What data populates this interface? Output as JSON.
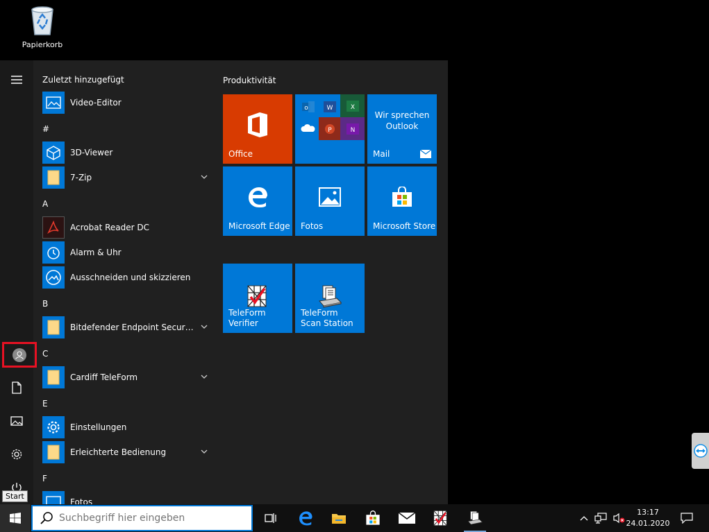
{
  "desktop": {
    "recycle_bin_label": "Papierkorb"
  },
  "start_menu": {
    "tooltip": "Start",
    "app_list": {
      "recent_title": "Zuletzt hinzugefügt",
      "items": [
        {
          "type": "app",
          "label": "Video-Editor",
          "icon": "video-editor-icon",
          "expand": false
        },
        {
          "type": "letter",
          "label": "#"
        },
        {
          "type": "app",
          "label": "3D-Viewer",
          "icon": "3d-viewer-icon",
          "expand": false
        },
        {
          "type": "app",
          "label": "7-Zip",
          "icon": "folder-icon",
          "expand": true
        },
        {
          "type": "letter",
          "label": "A"
        },
        {
          "type": "app",
          "label": "Acrobat Reader DC",
          "icon": "acrobat-icon",
          "expand": false
        },
        {
          "type": "app",
          "label": "Alarm & Uhr",
          "icon": "alarm-clock-icon",
          "expand": false
        },
        {
          "type": "app",
          "label": "Ausschneiden und skizzieren",
          "icon": "snip-sketch-icon",
          "expand": false
        },
        {
          "type": "letter",
          "label": "B"
        },
        {
          "type": "app",
          "label": "Bitdefender Endpoint Security T...",
          "icon": "folder-icon",
          "expand": true
        },
        {
          "type": "letter",
          "label": "C"
        },
        {
          "type": "app",
          "label": "Cardiff TeleForm",
          "icon": "folder-icon",
          "expand": true
        },
        {
          "type": "letter",
          "label": "E"
        },
        {
          "type": "app",
          "label": "Einstellungen",
          "icon": "settings-gear-icon",
          "expand": false
        },
        {
          "type": "app",
          "label": "Erleichterte Bedienung",
          "icon": "folder-icon",
          "expand": true
        },
        {
          "type": "letter",
          "label": "F"
        },
        {
          "type": "app",
          "label": "Fotos",
          "icon": "photos-icon",
          "expand": false
        }
      ]
    },
    "tiles": {
      "group_title": "Produktivität",
      "office_label": "Office",
      "mail_text": "Wir sprechen Outlook",
      "mail_label": "Mail",
      "edge_label": "Microsoft Edge",
      "fotos_label": "Fotos",
      "store_label": "Microsoft Store",
      "teleform_verifier_label": "TeleForm Verifier",
      "teleform_scan_label": "TeleForm Scan Station"
    }
  },
  "taskbar": {
    "search_placeholder": "Suchbegriff hier eingeben",
    "clock_time": "13:17",
    "clock_date": "24.01.2020"
  },
  "colors": {
    "accent": "#0078d7",
    "office": "#d83b01",
    "highlight": "#e81123"
  }
}
